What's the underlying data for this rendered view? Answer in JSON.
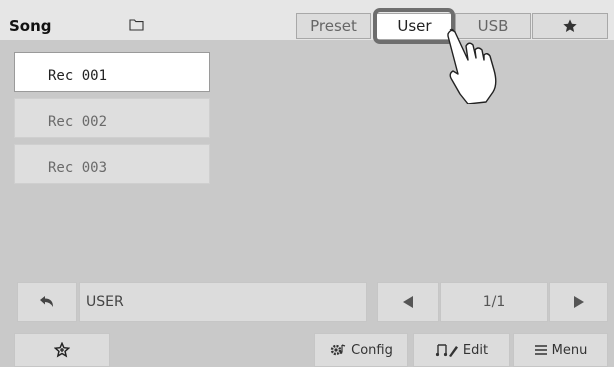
{
  "header": {
    "title": "Song",
    "folder_icon": "folder-icon",
    "tabs": [
      {
        "label": "Preset",
        "active": false
      },
      {
        "label": "User",
        "active": true
      },
      {
        "label": "USB",
        "active": false
      },
      {
        "label": "",
        "icon": "star-icon",
        "active": false
      }
    ]
  },
  "file_list": {
    "items": [
      {
        "label": "Rec 001",
        "selected": true
      },
      {
        "label": "Rec 002",
        "selected": false
      },
      {
        "label": "Rec 003",
        "selected": false
      }
    ]
  },
  "path_bar": {
    "back_icon": "back-arrow-icon",
    "path": "USER",
    "prev_icon": "triangle-left-icon",
    "page_indicator": "1/1",
    "next_icon": "triangle-right-icon"
  },
  "bottom_bar": {
    "favorite_icon": "star-plus-icon",
    "config_label": "Config",
    "edit_label": "Edit",
    "menu_label": "Menu"
  },
  "colors": {
    "background": "#c9c9c9",
    "active_tab": "#ffffff",
    "highlight_border": "#6e6e6e"
  }
}
